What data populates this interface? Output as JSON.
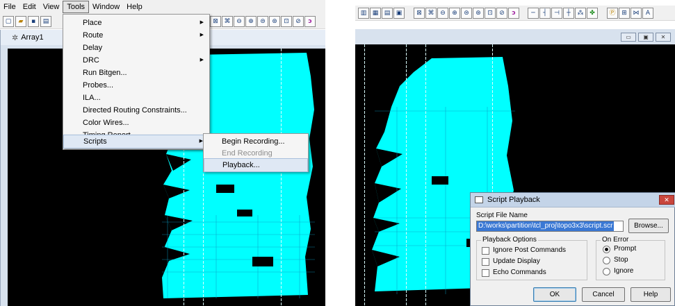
{
  "menubar": {
    "items": [
      "File",
      "Edit",
      "View",
      "Tools",
      "Window",
      "Help"
    ],
    "open_item": "Tools"
  },
  "left": {
    "window_title": "Array1",
    "window_icon": "array-window-icon"
  },
  "tools_menu": {
    "items": [
      {
        "label": "Place",
        "submenu": true
      },
      {
        "label": "Route",
        "submenu": true
      },
      {
        "label": "Delay",
        "submenu": false
      },
      {
        "label": "DRC",
        "submenu": true
      },
      {
        "label": "Run Bitgen...",
        "submenu": false
      },
      {
        "label": "Probes...",
        "submenu": false
      },
      {
        "label": "ILA...",
        "submenu": false
      },
      {
        "label": "Directed Routing Constraints...",
        "submenu": false
      },
      {
        "label": "Color Wires...",
        "submenu": false
      },
      {
        "label": "Timing Report...",
        "submenu": false
      },
      {
        "label": "Scripts",
        "submenu": true
      }
    ],
    "highlighted": "Scripts"
  },
  "scripts_submenu": {
    "items": [
      {
        "label": "Begin Recording...",
        "enabled": true
      },
      {
        "label": "End Recording",
        "enabled": false
      },
      {
        "label": "Playback...",
        "enabled": true
      }
    ],
    "highlighted": "Playback..."
  },
  "dialog": {
    "title": "Script Playback",
    "close_glyph": "✕",
    "file_label": "Script File Name",
    "file_value": "D:\\works\\partition\\tcl_proj\\topo3x3\\script.scr",
    "browse_label": "Browse...",
    "options_group": "Playback Options",
    "options": [
      {
        "label": "Ignore Post Commands",
        "checked": false
      },
      {
        "label": "Update Display",
        "checked": false
      },
      {
        "label": "Echo Commands",
        "checked": false
      }
    ],
    "error_group": "On Error",
    "error_options": [
      {
        "label": "Prompt",
        "selected": true
      },
      {
        "label": "Stop",
        "selected": false
      },
      {
        "label": "Ignore",
        "selected": false
      }
    ],
    "ok_label": "OK",
    "cancel_label": "Cancel",
    "help_label": "Help"
  },
  "toolbar_right": {
    "trailing_text": "A"
  },
  "colors": {
    "routing": "#00ffff",
    "canvas": "#000000",
    "menu_highlight": "#dfe8f4"
  }
}
